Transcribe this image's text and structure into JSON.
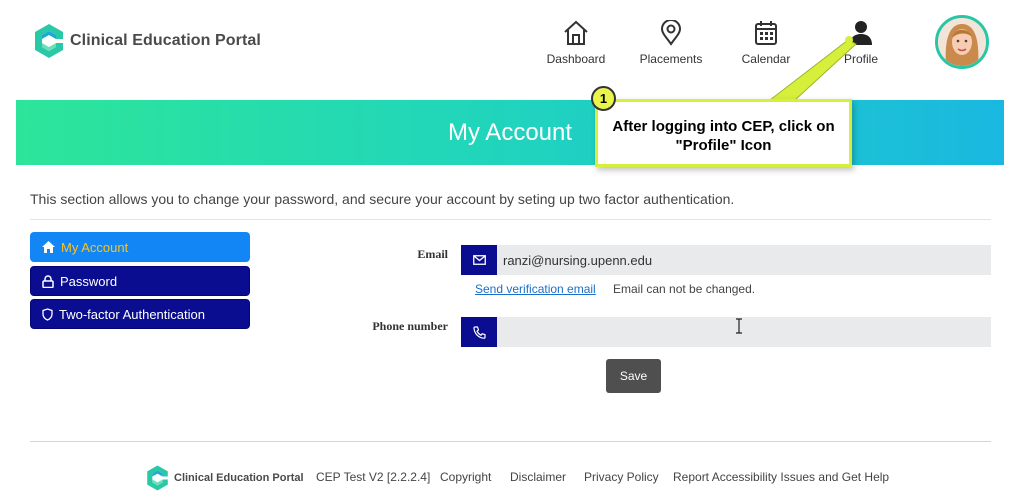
{
  "app": {
    "logo_text": "Clinical Education Portal"
  },
  "nav": {
    "dashboard": "Dashboard",
    "placements": "Placements",
    "calendar": "Calendar",
    "profile": "Profile"
  },
  "banner": {
    "title": "My Account"
  },
  "callout": {
    "step": "1",
    "text": "After logging into CEP, click on \"Profile\" Icon"
  },
  "description": "This section allows you to change your password, and secure your account by seting up two factor authentication.",
  "menu": {
    "my_account": "My Account",
    "password": "Password",
    "two_factor": "Two-factor Authentication"
  },
  "form": {
    "email_label": "Email",
    "email_value": "ranzi@nursing.upenn.edu",
    "verify_link": "Send verification email",
    "email_note": "Email can not be changed.",
    "phone_label": "Phone number",
    "phone_value": "",
    "save_label": "Save"
  },
  "footer": {
    "logo_text": "Clinical Education Portal",
    "version": "CEP Test V2 [2.2.2.4]",
    "copyright": "Copyright",
    "disclaimer": "Disclaimer",
    "privacy": "Privacy Policy",
    "accessibility": "Report Accessibility Issues and Get Help"
  },
  "icons": {
    "logo": "cep-logo-icon",
    "dashboard": "home-icon",
    "placements": "map-pin-icon",
    "calendar": "calendar-icon",
    "profile": "user-icon",
    "my_account": "home-icon",
    "password": "lock-icon",
    "two_factor": "shield-icon",
    "email": "envelope-icon",
    "phone": "phone-icon"
  },
  "colors": {
    "brand_navy": "#0a0d8f",
    "active_menu": "#1386f5",
    "active_menu_text": "#ffc21a",
    "banner_start": "#2de59a",
    "banner_end": "#1ab8e0",
    "callout_border": "#d6ef3a",
    "link": "#1a6fc9"
  }
}
